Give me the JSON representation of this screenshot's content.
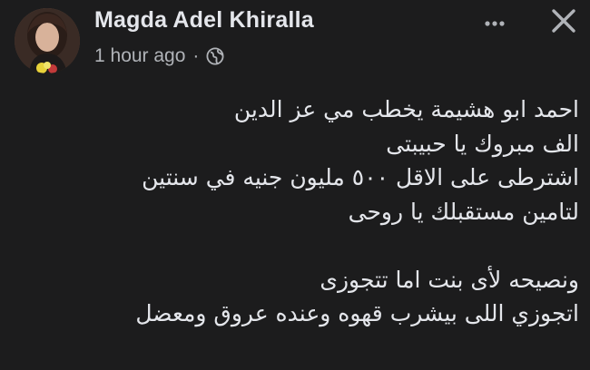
{
  "post": {
    "author_name": "Magda Adel Khiralla",
    "timestamp": "1 hour ago",
    "separator": "·",
    "privacy_icon": "globe-icon",
    "more_icon": "more-horizontal-icon",
    "close_icon": "close-icon",
    "lines": [
      "احمد ابو هشيمة يخطب مي عز الدين",
      "الف مبروك يا حبيبتى",
      "اشترطى على الاقل ٥٠٠ مليون جنيه في سنتين",
      "لتامين مستقبلك يا روحى",
      "ونصيحه لأى بنت اما تتجوزى",
      "اتجوزي اللى بيشرب قهوه وعنده عروق ومعضل"
    ]
  },
  "colors": {
    "background": "#1c1c1d",
    "primary_text": "#e4e6eb",
    "secondary_text": "#b0b3b8"
  }
}
